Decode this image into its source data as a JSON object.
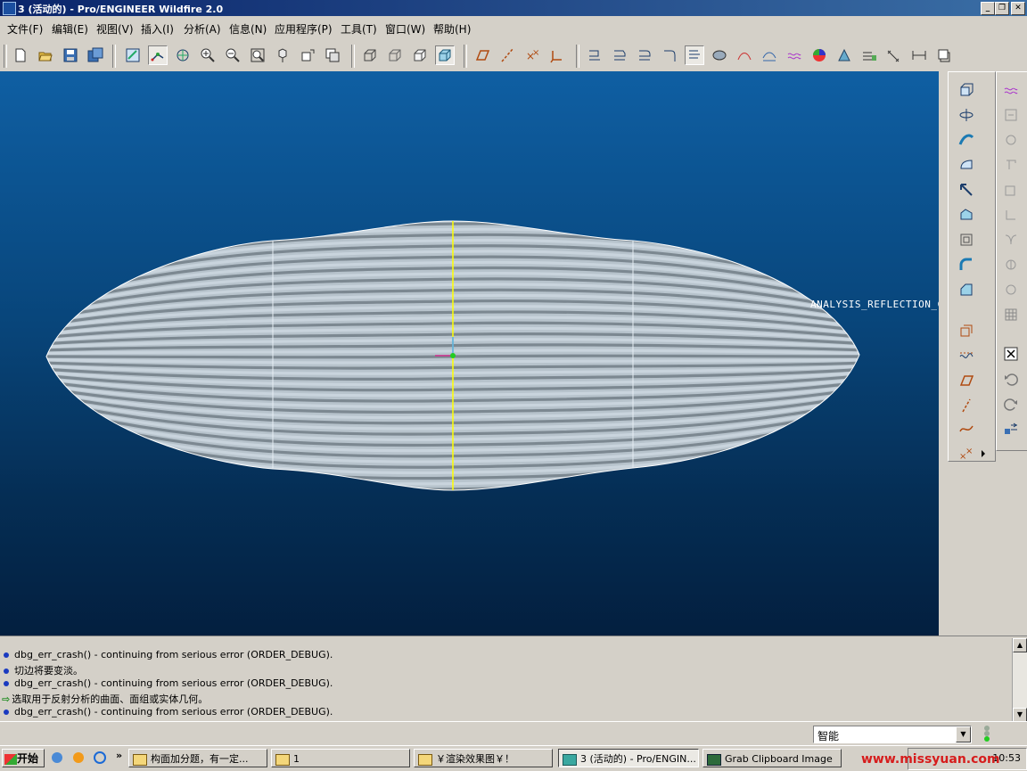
{
  "window": {
    "title": "3 (活动的) - Pro/ENGINEER Wildfire 2.0",
    "controls": [
      "_",
      "❐",
      "✕"
    ]
  },
  "menu": [
    "文件(F)",
    "编辑(E)",
    "视图(V)",
    "插入(I)",
    "分析(A)",
    "信息(N)",
    "应用程序(P)",
    "工具(T)",
    "窗口(W)",
    "帮助(H)"
  ],
  "toolbar_icons": [
    "new-file",
    "open-file",
    "save",
    "save-copy",
    "repaint",
    "spin-center",
    "orient-mode",
    "zoom-in",
    "zoom-out",
    "refit",
    "view-manager",
    "saved-views",
    "layers",
    "wireframe",
    "hidden-line",
    "no-hidden",
    "shading",
    "datum-planes",
    "datum-axes",
    "datum-points",
    "coord-systems",
    "dim-1",
    "dim-2",
    "dim-3",
    "dim-4",
    "dim-5",
    "analysis-1",
    "analysis-2",
    "analysis-3",
    "analysis-4",
    "analysis-5",
    "analysis-6",
    "analysis-7",
    "analysis-8",
    "analysis-9",
    "analysis-10"
  ],
  "viewport": {
    "annotation": "ANALYSIS_REFLECTION_C",
    "background_top": "#0f5fa3",
    "background_bottom": "#031f3f",
    "stripe_light": "#c9d4dd",
    "stripe_dark": "#7c8891"
  },
  "messages": [
    {
      "type": "info",
      "text": "dbg_err_crash() - continuing from serious error (ORDER_DEBUG)."
    },
    {
      "type": "info",
      "text": "切边将要变淡。"
    },
    {
      "type": "info",
      "text": "dbg_err_crash() - continuing from serious error (ORDER_DEBUG)."
    },
    {
      "type": "prompt",
      "text": "选取用于反射分析的曲面、面组或实体几何。"
    },
    {
      "type": "info",
      "text": "dbg_err_crash() - continuing from serious error (ORDER_DEBUG)."
    }
  ],
  "status": {
    "filter_value": "智能"
  },
  "taskbar": {
    "start": "开始",
    "tasks": [
      {
        "label": "构面加分题，有一定...",
        "active": false
      },
      {
        "label": "1",
        "active": false
      },
      {
        "label": "￥渲染效果图￥！",
        "active": false
      },
      {
        "label": "3 (活动的) - Pro/ENGIN...",
        "active": true
      },
      {
        "label": "Grab Clipboard Image",
        "active": false
      }
    ],
    "clock": "10:53",
    "watermark": "www.missyuan.com"
  }
}
